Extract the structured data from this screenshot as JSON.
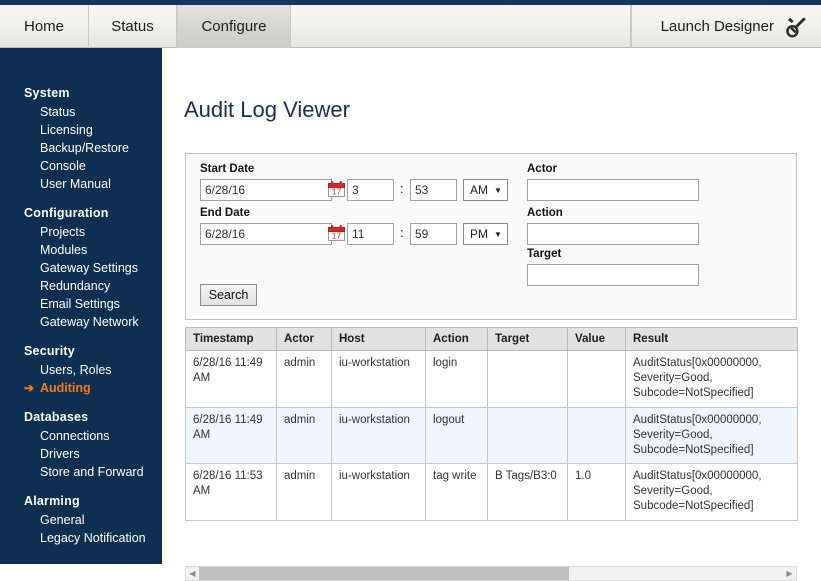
{
  "topnav": {
    "tabs": [
      {
        "label": "Home",
        "name": "tab-home",
        "selected": false
      },
      {
        "label": "Status",
        "name": "tab-status",
        "selected": false
      },
      {
        "label": "Configure",
        "name": "tab-configure",
        "selected": true
      }
    ],
    "launch_designer_label": "Launch Designer",
    "launch_designer_icon": "wrench-icon"
  },
  "sidebar": {
    "groups": [
      {
        "title": "System",
        "items": [
          "Status",
          "Licensing",
          "Backup/Restore",
          "Console",
          "User Manual"
        ]
      },
      {
        "title": "Configuration",
        "items": [
          "Projects",
          "Modules",
          "Gateway Settings",
          "Redundancy",
          "Email Settings",
          "Gateway Network"
        ]
      },
      {
        "title": "Security",
        "items": [
          "Users, Roles",
          "Auditing"
        ],
        "active": "Auditing"
      },
      {
        "title": "Databases",
        "items": [
          "Connections",
          "Drivers",
          "Store and Forward"
        ]
      },
      {
        "title": "Alarming",
        "items": [
          "General",
          "Legacy Notification"
        ]
      }
    ],
    "active_item": "Auditing",
    "active_arrow_icon": "arrow-right-icon"
  },
  "main": {
    "page_title": "Audit Log Viewer"
  },
  "search_form": {
    "start_date": {
      "label": "Start Date",
      "date_value": "6/28/16",
      "calendar_icon": "calendar-icon",
      "hour_value": "3",
      "separator": ":",
      "minute_value": "53",
      "ampm_value": "AM"
    },
    "end_date": {
      "label": "End Date",
      "date_value": "6/28/16",
      "calendar_icon": "calendar-icon",
      "hour_value": "11",
      "separator": ":",
      "minute_value": "59",
      "ampm_value": "PM"
    },
    "actor": {
      "label": "Actor",
      "value": ""
    },
    "action": {
      "label": "Action",
      "value": ""
    },
    "target": {
      "label": "Target",
      "value": ""
    },
    "search_button": "Search"
  },
  "table": {
    "columns": [
      "Timestamp",
      "Actor",
      "Host",
      "Action",
      "Target",
      "Value",
      "Result"
    ],
    "rows": [
      {
        "timestamp": "6/28/16 11:49 AM",
        "actor": "admin",
        "host": "iu-workstation",
        "action": "login",
        "target": "",
        "value": "",
        "result": "AuditStatus[0x00000000, Severity=Good, Subcode=NotSpecified]"
      },
      {
        "timestamp": "6/28/16 11:49 AM",
        "actor": "admin",
        "host": "iu-workstation",
        "action": "logout",
        "target": "",
        "value": "",
        "result": "AuditStatus[0x00000000, Severity=Good, Subcode=NotSpecified]"
      },
      {
        "timestamp": "6/28/16 11:53 AM",
        "actor": "admin",
        "host": "iu-workstation",
        "action": "tag write",
        "target": "B Tags/B3:0",
        "value": "1.0",
        "result": "AuditStatus[0x00000000, Severity=Good, Subcode=NotSpecified]"
      }
    ],
    "scrollbar": {
      "left_icon": "triangle-left-icon",
      "right_icon": "triangle-right-icon"
    }
  },
  "colors": {
    "navy": "#0d3052",
    "topstrip": "#14365c",
    "accent_orange": "#f07d16",
    "title_blue": "#1b2f4b",
    "row_alt": "#eef5fc"
  }
}
